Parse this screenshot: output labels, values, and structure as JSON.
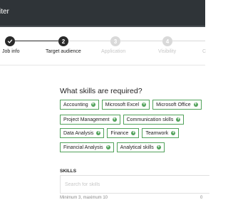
{
  "header": {
    "title_fragment": "iter"
  },
  "steps": [
    {
      "label": "Job info",
      "number": "",
      "state": "done"
    },
    {
      "label": "Target audience",
      "number": "2",
      "state": "active"
    },
    {
      "label": "Application",
      "number": "3",
      "state": "todo"
    },
    {
      "label": "Visibility",
      "number": "4",
      "state": "todo"
    },
    {
      "label": "C",
      "number": "",
      "state": "todo"
    }
  ],
  "question": "What skills are required?",
  "skill_chips": {
    "row1": [
      "Accounting",
      "Microsoft Excel",
      "Microsoft Office"
    ],
    "row2": [
      "Project Management",
      "Communication skills"
    ],
    "row3": [
      "Data Analysis",
      "Finance",
      "Teamwork"
    ],
    "row4": [
      "Financial Analysis",
      "Analytical skills"
    ]
  },
  "skills_field": {
    "label": "SKILLS",
    "placeholder": "Search for skills",
    "hint": "Minimum 3, maximum 10",
    "counter": "0"
  },
  "colors": {
    "accent": "#52a25b",
    "dark": "#2a2a2a",
    "topbar": "#2f3438"
  },
  "icons": {
    "done_step": "check-icon",
    "chip_add": "plus-circle-icon"
  }
}
